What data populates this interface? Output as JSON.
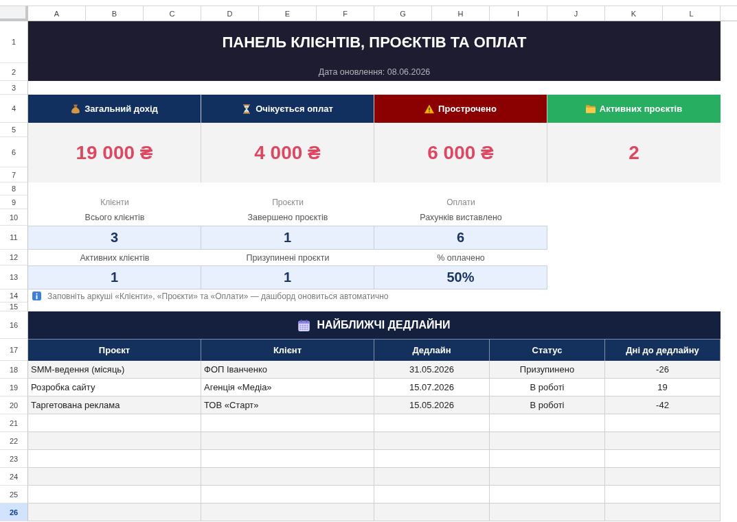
{
  "sheet": {
    "columns": [
      {
        "label": "A",
        "selected": false
      },
      {
        "label": "B",
        "selected": false
      },
      {
        "label": "C",
        "selected": false
      },
      {
        "label": "D",
        "selected": false
      },
      {
        "label": "E",
        "selected": false
      },
      {
        "label": "F",
        "selected": false
      },
      {
        "label": "G",
        "selected": false
      },
      {
        "label": "H",
        "selected": false
      },
      {
        "label": "I",
        "selected": false
      },
      {
        "label": "J",
        "selected": false
      },
      {
        "label": "K",
        "selected": false
      },
      {
        "label": "L",
        "selected": false
      }
    ],
    "rows": [
      {
        "label": "1",
        "selected": false
      },
      {
        "label": "2",
        "selected": false
      },
      {
        "label": "3",
        "selected": false
      },
      {
        "label": "4",
        "selected": false
      },
      {
        "label": "5",
        "selected": false
      },
      {
        "label": "6",
        "selected": false
      },
      {
        "label": "7",
        "selected": false
      },
      {
        "label": "8",
        "selected": false
      },
      {
        "label": "9",
        "selected": false
      },
      {
        "label": "10",
        "selected": false
      },
      {
        "label": "11",
        "selected": false
      },
      {
        "label": "12",
        "selected": false
      },
      {
        "label": "13",
        "selected": false
      },
      {
        "label": "14",
        "selected": false
      },
      {
        "label": "15",
        "selected": false
      },
      {
        "label": "16",
        "selected": false
      },
      {
        "label": "17",
        "selected": false
      },
      {
        "label": "18",
        "selected": false
      },
      {
        "label": "19",
        "selected": false
      },
      {
        "label": "20",
        "selected": false
      },
      {
        "label": "21",
        "selected": false
      },
      {
        "label": "22",
        "selected": false
      },
      {
        "label": "23",
        "selected": false
      },
      {
        "label": "24",
        "selected": false
      },
      {
        "label": "25",
        "selected": false
      },
      {
        "label": "26",
        "selected": true
      }
    ]
  },
  "dashboard": {
    "title": "ПАНЕЛЬ КЛІЄНТІВ, ПРОЄКТІВ ТА ОПЛАТ",
    "updated": "Дата оновлення: 08.06.2026",
    "kpi_cards": [
      {
        "label": "Загальний дохід",
        "value": "19 000 ₴",
        "color": "#12305f"
      },
      {
        "label": "Очікується оплат",
        "value": "4 000 ₴",
        "color": "#12305f"
      },
      {
        "label": "Прострочено",
        "value": "6 000 ₴",
        "color": "#8b0000"
      },
      {
        "label": "Активних проєктів",
        "value": "2",
        "color": "#27ae60"
      }
    ],
    "stat_groups": [
      {
        "title": "Клієнти",
        "metrics": [
          {
            "label": "Всього клієнтів",
            "value": "3"
          },
          {
            "label": "Активних клієнтів",
            "value": "1"
          }
        ]
      },
      {
        "title": "Проєкти",
        "metrics": [
          {
            "label": "Завершено проєктів",
            "value": "1"
          },
          {
            "label": "Призупинені проєкти",
            "value": "1"
          }
        ]
      },
      {
        "title": "Оплати",
        "metrics": [
          {
            "label": "Рахунків виставлено",
            "value": "6"
          },
          {
            "label": "% оплачено",
            "value": "50%"
          }
        ]
      }
    ],
    "note": "Заповніть аркуші «Клієнти», «Проєкти» та «Оплати» — дашборд оновиться автоматично",
    "deadlines": {
      "title": "НАЙБЛИЖЧІ ДЕДЛАЙНИ",
      "columns": [
        "Проєкт",
        "Клієнт",
        "Дедлайн",
        "Статус",
        "Дні до дедлайну"
      ],
      "rows": [
        [
          "SMM-ведення (місяць)",
          "ФОП Іванченко",
          "31.05.2026",
          "Призупинено",
          "-26"
        ],
        [
          "Розробка сайту",
          "Агенція «Медіа»",
          "15.07.2026",
          "В роботі",
          "19"
        ],
        [
          "Таргетована реклама",
          "ТОВ «Старт»",
          "15.05.2026",
          "В роботі",
          "-42"
        ]
      ]
    }
  }
}
